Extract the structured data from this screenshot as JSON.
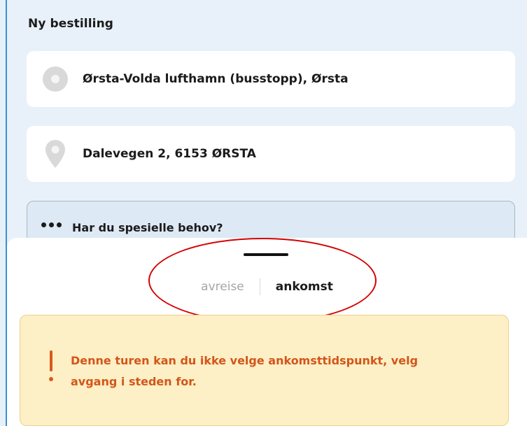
{
  "page": {
    "title": "Ny bestilling"
  },
  "route": {
    "from": {
      "label": "Ørsta-Volda lufthamn (busstopp), Ørsta",
      "icon": "stop-circle-icon"
    },
    "to": {
      "label": "Dalevegen 2, 6153 ØRSTA",
      "icon": "map-pin-icon"
    }
  },
  "needs": {
    "label": "Har du spesielle behov?",
    "icon": "more-dots-icon"
  },
  "time_mode": {
    "tabs": [
      {
        "label": "avreise",
        "active": false
      },
      {
        "label": "ankomst",
        "active": true
      }
    ]
  },
  "warning": {
    "icon": "exclamation-icon",
    "message": "Denne turen kan du ikke velge ankomsttidspunkt, velg avgang i steden for.",
    "color": "#d2561a",
    "background": "#fdefc6"
  },
  "colors": {
    "accent": "#3a8fd6",
    "highlight": "#d40000"
  }
}
